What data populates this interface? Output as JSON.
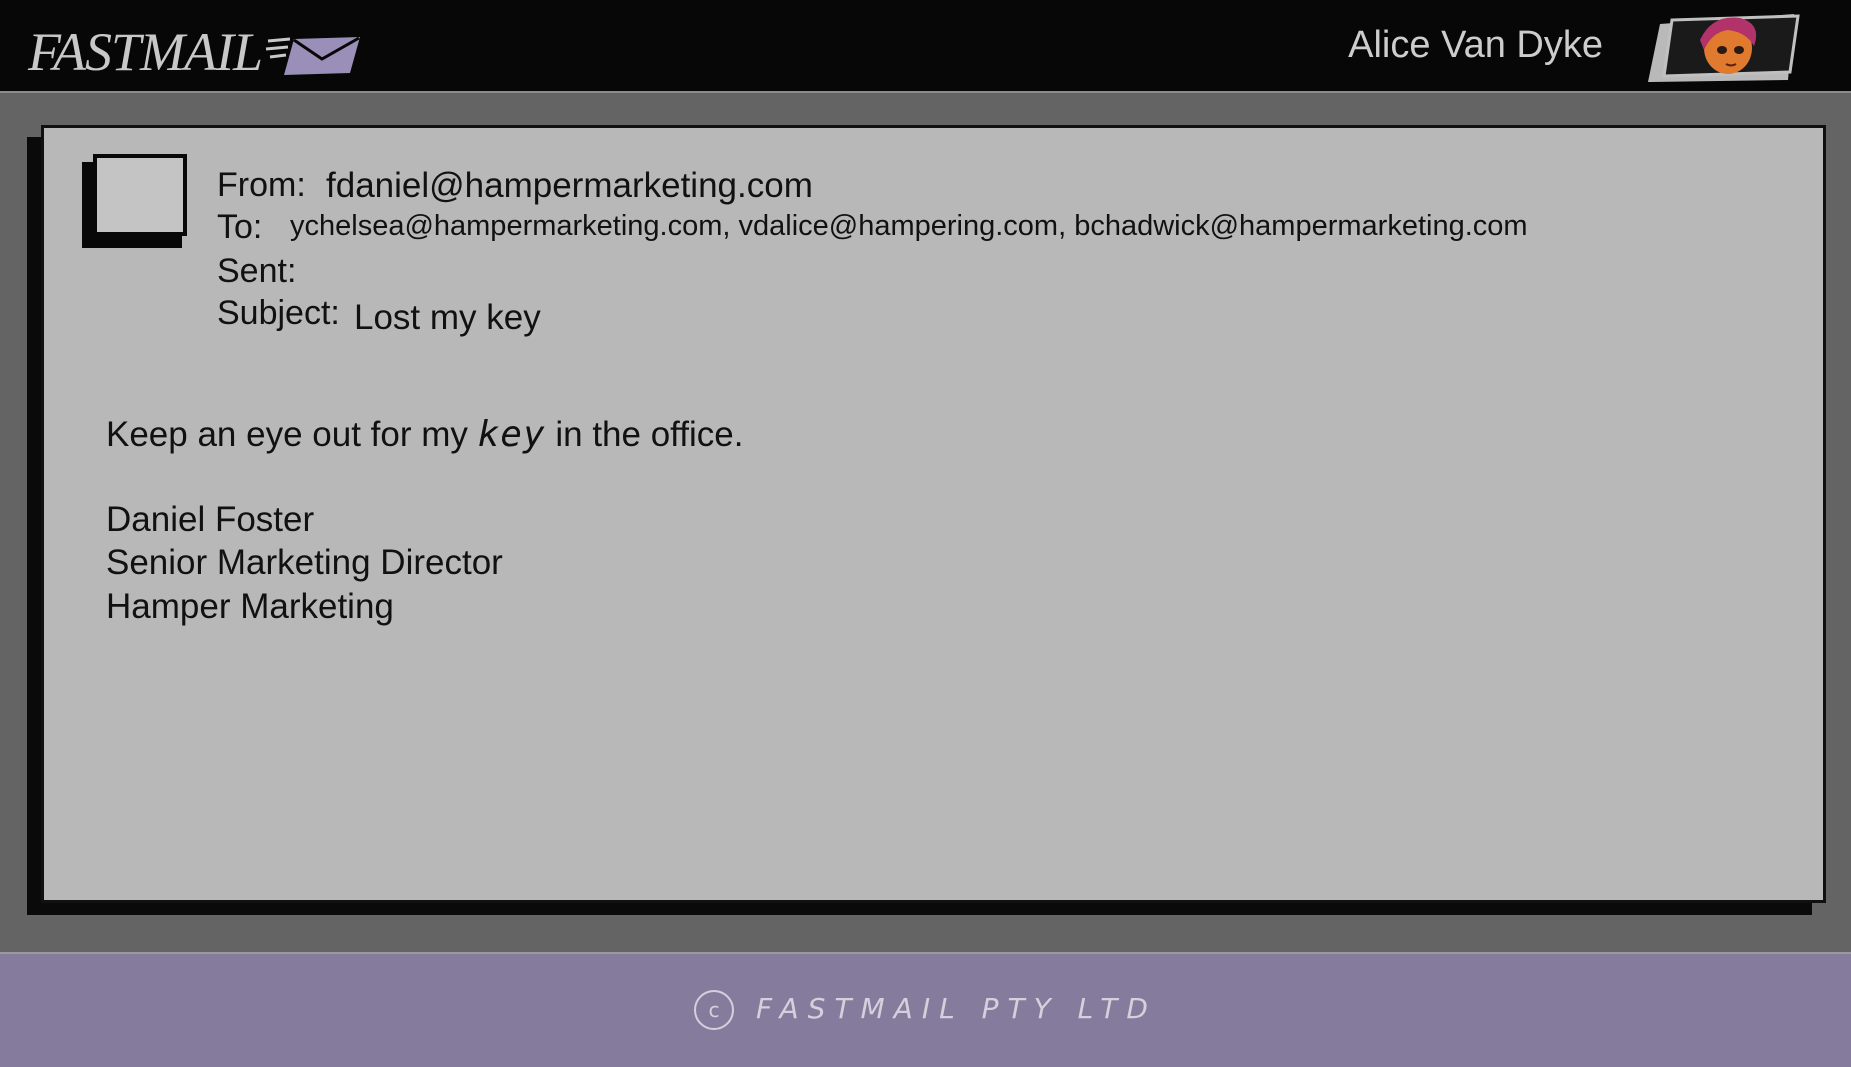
{
  "header": {
    "logo_text": "FASTMAIL",
    "user_name": "Alice Van Dyke",
    "icons": {
      "logo": "envelope-icon",
      "user": "avatar-icon"
    }
  },
  "email": {
    "from_label": "From:",
    "from_value": "fdaniel@hampermarketing.com",
    "to_label": "To:",
    "to_value": "ychelsea@hampermarketing.com, vdalice@hampering.com, bchadwick@hampermarketing.com",
    "sent_label": "Sent:",
    "sent_value": "",
    "subject_label": "Subject:",
    "subject_value": "Lost my key",
    "body_prefix": "Keep an eye out for my ",
    "body_handwritten": "key",
    "body_suffix": " in the office.",
    "signature": [
      "Daniel Foster",
      "Senior Marketing Director",
      "Hamper Marketing"
    ]
  },
  "footer": {
    "copyright_symbol": "c",
    "text": "FASTMAIL PTY LTD"
  },
  "colors": {
    "topbar": "#070707",
    "background": "#646464",
    "card": "#b8b8b8",
    "footer": "#857c9d",
    "envelope": "#9a8fb8"
  }
}
